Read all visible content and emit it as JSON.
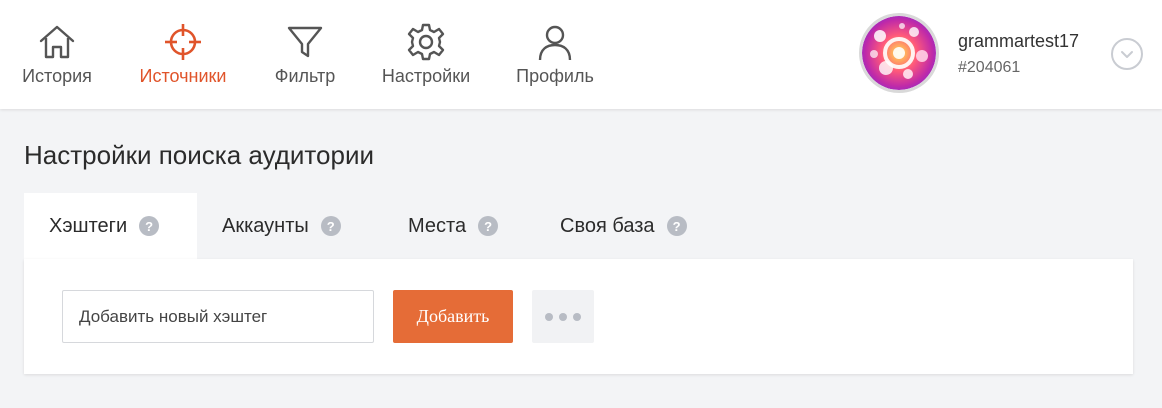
{
  "nav": {
    "items": [
      {
        "label": "История",
        "icon": "home-icon",
        "active": false
      },
      {
        "label": "Источники",
        "icon": "crosshair-icon",
        "active": true
      },
      {
        "label": "Фильтр",
        "icon": "filter-icon",
        "active": false
      },
      {
        "label": "Настройки",
        "icon": "gear-icon",
        "active": false
      },
      {
        "label": "Профиль",
        "icon": "user-icon",
        "active": false
      }
    ]
  },
  "user": {
    "name": "grammartest17",
    "id": "#204061",
    "menu_icon": "chevron-down-icon"
  },
  "page": {
    "title": "Настройки поиска аудитории"
  },
  "tabs": [
    {
      "label": "Хэштеги",
      "help": "?",
      "active": true
    },
    {
      "label": "Аккаунты",
      "help": "?",
      "active": false
    },
    {
      "label": "Места",
      "help": "?",
      "active": false
    },
    {
      "label": "Своя база",
      "help": "?",
      "active": false
    }
  ],
  "form": {
    "input_placeholder": "Добавить новый хэштег",
    "add_button": "Добавить",
    "more_icon": "more-dots-icon"
  },
  "colors": {
    "accent": "#e56c37",
    "active_nav": "#e0542a",
    "background": "#f3f4f6"
  }
}
